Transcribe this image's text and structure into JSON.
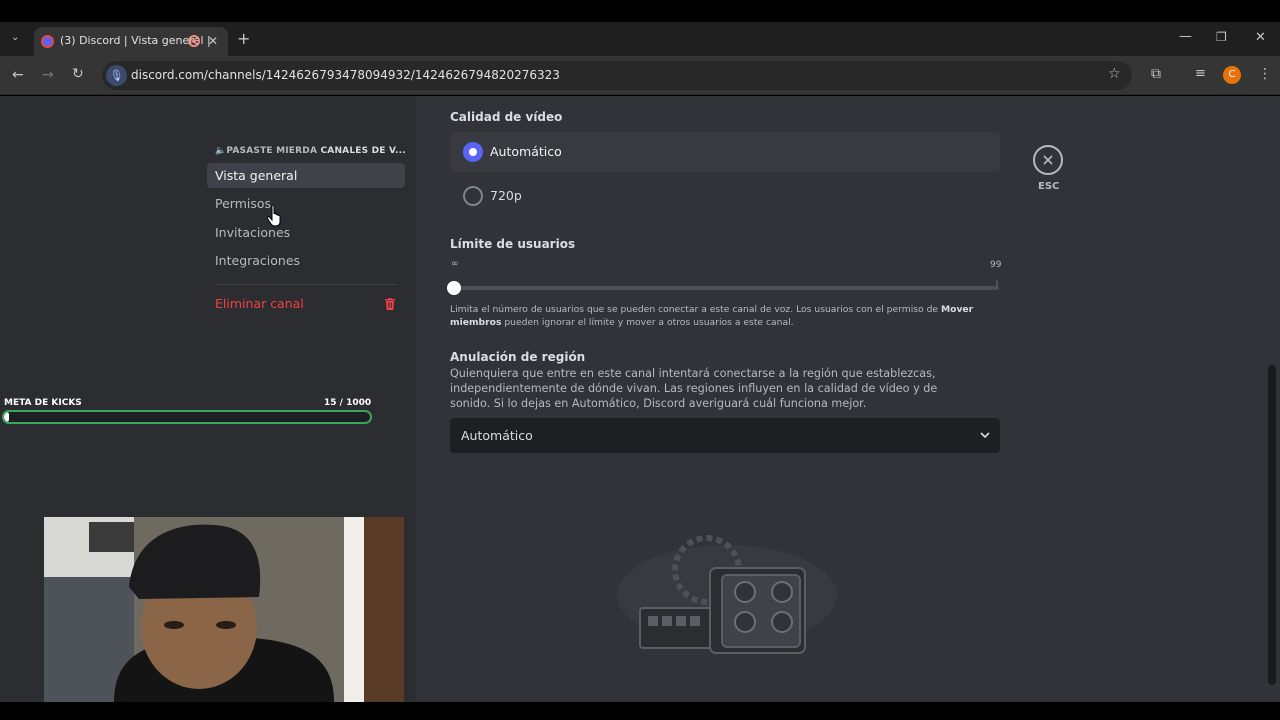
{
  "browser": {
    "tab_title": "(3) Discord | Vista general |",
    "url": "discord.com/channels/1424626793478094932/1424626794820276323",
    "profile_initial": "C"
  },
  "sidebar": {
    "breadcrumb_server": "🔈PASASTE MIERDA",
    "breadcrumb_channel": "CANALES DE V...",
    "items": [
      {
        "label": "Vista general",
        "active": true
      },
      {
        "label": "Permisos",
        "active": false
      },
      {
        "label": "Invitaciones",
        "active": false
      },
      {
        "label": "Integraciones",
        "active": false
      }
    ],
    "delete_label": "Eliminar canal",
    "delete_color": "#f23f43"
  },
  "overlay": {
    "kicks_label": "META DE KICKS",
    "kicks_count": "15  / 1000",
    "kicks_progress": 0.015,
    "bar_color": "#3ba55c"
  },
  "main": {
    "video_quality_title": "Calidad de vídeo",
    "video_options": [
      {
        "label": "Automático",
        "selected": true
      },
      {
        "label": "720p",
        "selected": false
      }
    ],
    "user_limit_title": "Límite de usuarios",
    "slider_min_label": "∞",
    "slider_max_label": "99",
    "slider_value": 0,
    "user_limit_help_1": "Limita el número de usuarios que se pueden conectar a este canal de voz. Los usuarios con el permiso de ",
    "user_limit_help_bold": "Mover miembros",
    "user_limit_help_2": " pueden ignorar el límite y mover a otros usuarios a este canal.",
    "region_title": "Anulación de región",
    "region_desc": "Quienquiera que entre en este canal intentará conectarse a la región que establezcas, independientemente de dónde vivan. Las regiones influyen en la calidad de vídeo y de sonido. Si lo dejas en Automático, Discord averiguará cuál funciona mejor.",
    "region_select_value": "Automático",
    "close_label": "ESC",
    "accent": "#5865f2"
  }
}
